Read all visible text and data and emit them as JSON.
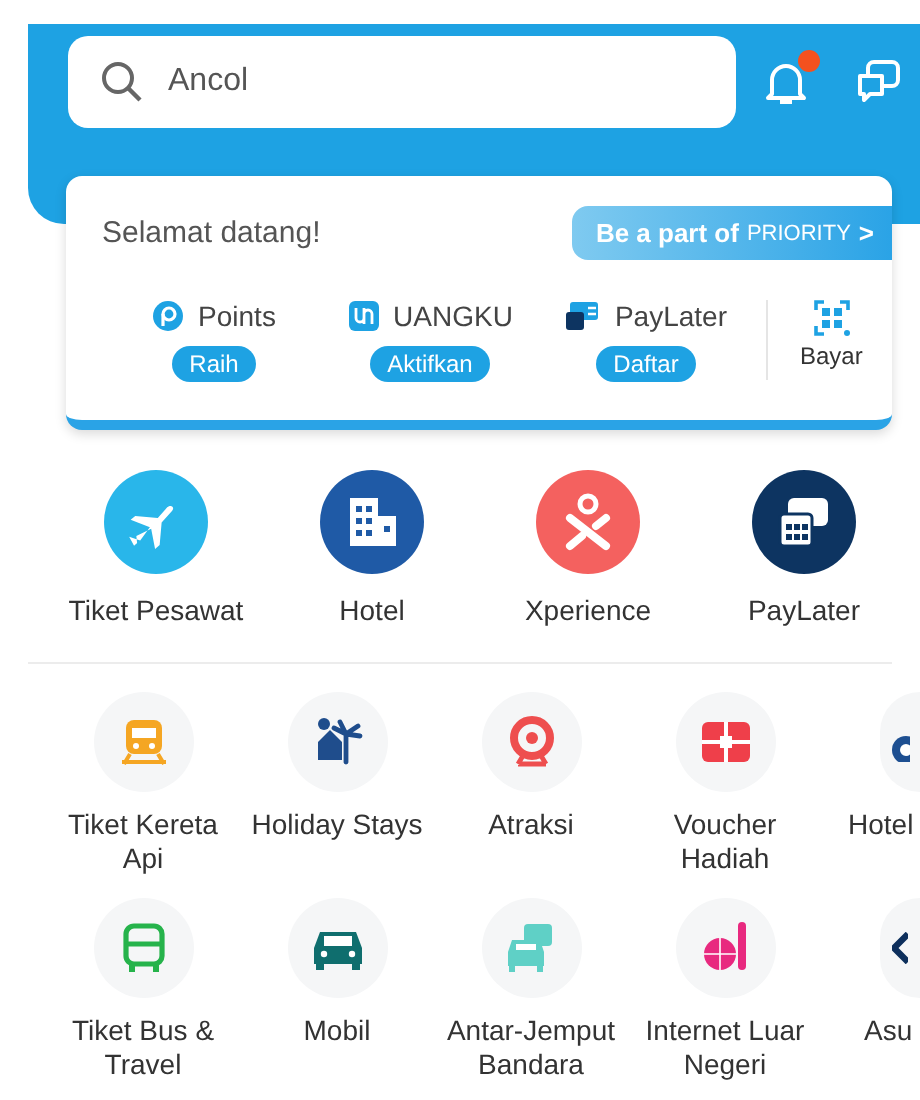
{
  "header": {
    "search": {
      "value": "Ancol"
    },
    "notifications": {
      "unread": true
    }
  },
  "welcome_card": {
    "greeting": "Selamat datang!",
    "priority_button": {
      "text": "Be a part of",
      "brand": "PRIORITY",
      "chevron": ">"
    },
    "wallets": [
      {
        "name": "Points",
        "action": "Raih"
      },
      {
        "name": "UANGKU",
        "action": "Aktifkan"
      },
      {
        "name": "PayLater",
        "action": "Daftar"
      }
    ],
    "pay": {
      "label": "Bayar"
    }
  },
  "main_products": [
    {
      "label": "Tiket Pesawat",
      "color": "#29b6ea"
    },
    {
      "label": "Hotel",
      "color": "#1f5aa6"
    },
    {
      "label": "Xperience",
      "color": "#f4615f"
    },
    {
      "label": "PayLater",
      "color": "#0d3461"
    }
  ],
  "services": [
    {
      "label": "Tiket Kereta Api",
      "color": "#f5a623"
    },
    {
      "label": "Holiday Stays",
      "color": "#1f4d8c"
    },
    {
      "label": "Atraksi",
      "color": "#ee4e4e"
    },
    {
      "label": "Voucher Hadiah",
      "color": "#ef3f4a"
    },
    {
      "label": "Hotel",
      "color": "#1d4f91"
    },
    {
      "label": "Tiket Bus & Travel",
      "color": "#26b34b"
    },
    {
      "label": "Mobil",
      "color": "#0f6e6e"
    },
    {
      "label": "Antar-Jemput Bandara",
      "color": "#5fd0c6"
    },
    {
      "label": "Internet Luar Negeri",
      "color": "#e8297f"
    },
    {
      "label": "Asu",
      "color": "#0d2f5c"
    }
  ]
}
